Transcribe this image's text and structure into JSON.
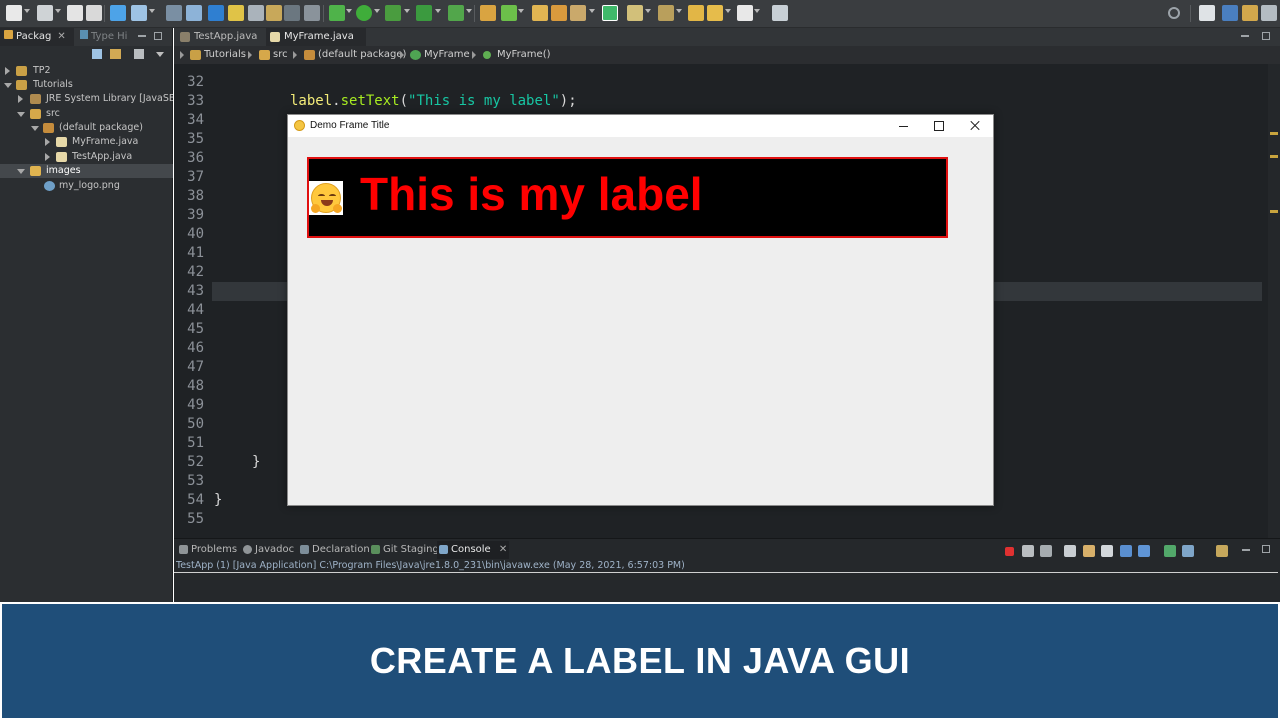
{
  "colors": {
    "ide_background": "#1f2225",
    "frame_background": "#eeeeee",
    "label_background": "#000000",
    "label_text": "#ff0000",
    "label_border": "#e01010",
    "banner_background": "#1f4e79",
    "banner_text": "#ffffff"
  },
  "toolbar": {
    "icons": [
      "new-icon",
      "save-icon",
      "print-icon",
      "debug-icon",
      "run-icon",
      "search-icon",
      "perspective-icon"
    ]
  },
  "explorer": {
    "tabs": [
      {
        "label": "Packag",
        "icon": "package-icon"
      },
      {
        "label": "Type Hi",
        "icon": "type-hierarchy-icon"
      }
    ],
    "tree": [
      {
        "label": "TP2",
        "icon": "project-icon"
      },
      {
        "label": "Tutorials",
        "icon": "project-icon"
      },
      {
        "label": "JRE System Library [JavaSE-1.8]",
        "icon": "library-icon"
      },
      {
        "label": "src",
        "icon": "source-folder-icon"
      },
      {
        "label": "(default package)",
        "icon": "package-icon"
      },
      {
        "label": "MyFrame.java",
        "icon": "java-file-icon"
      },
      {
        "label": "TestApp.java",
        "icon": "java-file-icon"
      },
      {
        "label": "images",
        "icon": "folder-icon"
      },
      {
        "label": "my_logo.png",
        "icon": "image-file-icon"
      }
    ]
  },
  "editor": {
    "tabs": [
      {
        "label": "TestApp.java"
      },
      {
        "label": "MyFrame.java",
        "close": "✕"
      }
    ],
    "breadcrumb": [
      "Tutorials",
      "src",
      "(default package)",
      "MyFrame",
      "MyFrame()"
    ],
    "line_numbers": [
      "32",
      "33",
      "34",
      "35",
      "36",
      "37",
      "38",
      "39",
      "40",
      "41",
      "42",
      "43",
      "44",
      "45",
      "46",
      "47",
      "48",
      "49",
      "50",
      "51",
      "52",
      "53",
      "54",
      "55"
    ],
    "code": {
      "line33": {
        "obj": "label",
        "dot": ".",
        "method": "setText",
        "open": "(",
        "str": "\"This is my label\"",
        "close": ");"
      },
      "line52": "}",
      "line54": "}"
    }
  },
  "console": {
    "tabs": [
      {
        "label": "Problems",
        "icon": "problems-icon"
      },
      {
        "label": "Javadoc",
        "icon": "javadoc-icon"
      },
      {
        "label": "Declaration",
        "icon": "declaration-icon"
      },
      {
        "label": "Git Staging",
        "icon": "git-icon"
      },
      {
        "label": "Console",
        "icon": "console-icon",
        "close": "✕"
      }
    ],
    "status": "TestApp (1) [Java Application] C:\\Program Files\\Java\\jre1.8.0_231\\bin\\javaw.exe (May 28, 2021, 6:57:03 PM)"
  },
  "demo_frame": {
    "title": "Demo Frame Title",
    "label_text": "This is my label",
    "label_icon": "smiling-face-icon"
  },
  "banner": {
    "text": "CREATE A LABEL IN JAVA GUI"
  }
}
